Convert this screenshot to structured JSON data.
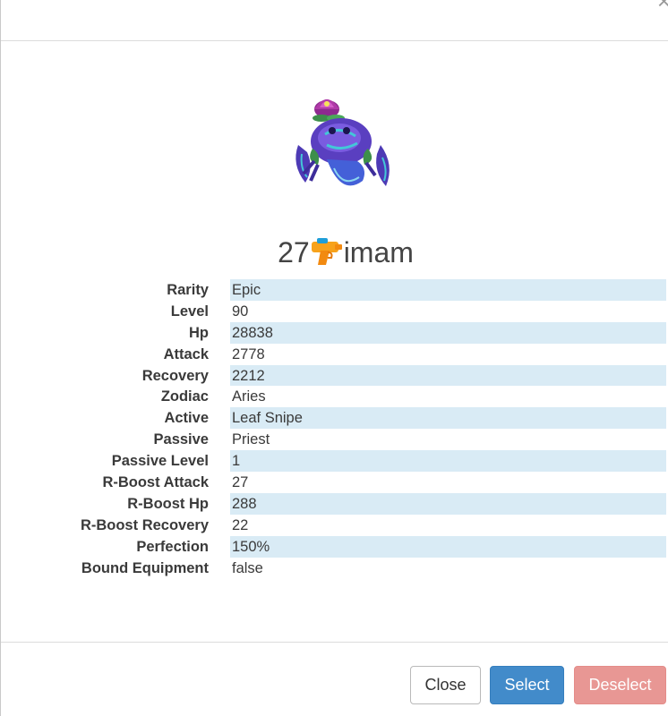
{
  "modal": {
    "close_glyph": "×"
  },
  "pet": {
    "image_icon": "lotus-crab-creature",
    "title_number": "27",
    "title_icon": "water-pistol-icon",
    "title_name": "imam"
  },
  "stats": [
    {
      "label": "Rarity",
      "value": "Epic"
    },
    {
      "label": "Level",
      "value": "90"
    },
    {
      "label": "Hp",
      "value": "28838"
    },
    {
      "label": "Attack",
      "value": "2778"
    },
    {
      "label": "Recovery",
      "value": "2212"
    },
    {
      "label": "Zodiac",
      "value": "Aries"
    },
    {
      "label": "Active",
      "value": "Leaf Snipe"
    },
    {
      "label": "Passive",
      "value": "Priest"
    },
    {
      "label": "Passive Level",
      "value": "1"
    },
    {
      "label": "R-Boost Attack",
      "value": "27"
    },
    {
      "label": "R-Boost Hp",
      "value": "288"
    },
    {
      "label": "R-Boost Recovery",
      "value": "22"
    },
    {
      "label": "Perfection",
      "value": "150%"
    },
    {
      "label": "Bound Equipment",
      "value": "false"
    }
  ],
  "footer": {
    "close_label": "Close",
    "select_label": "Select",
    "deselect_label": "Deselect"
  },
  "colors": {
    "stripe": "#d9ebf5",
    "select_button": "#428bca",
    "deselect_button": "#e89794"
  }
}
